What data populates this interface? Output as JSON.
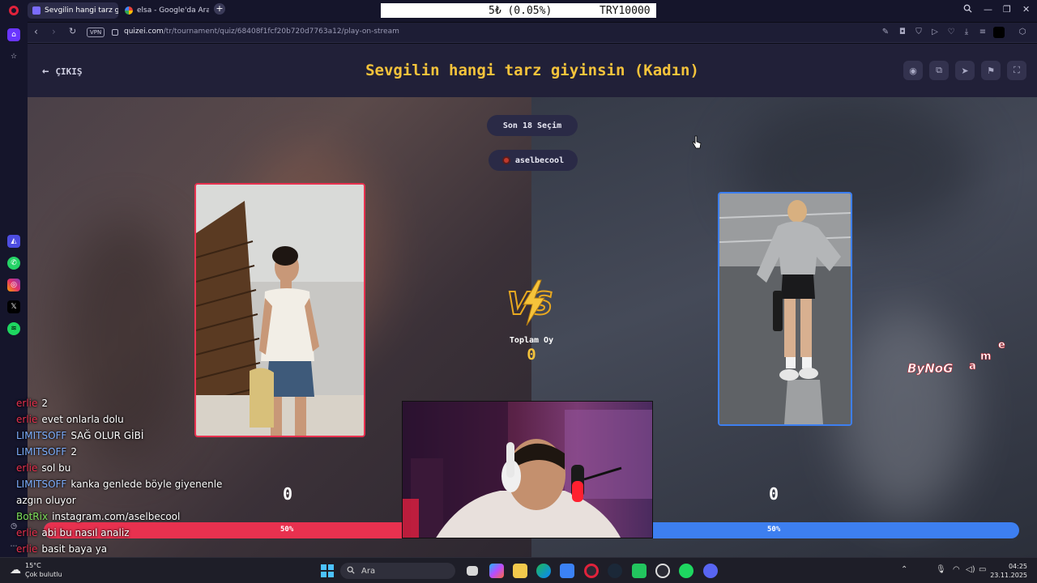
{
  "browser": {
    "tabs": [
      {
        "label": "Sevgilin hangi tarz giyinsin",
        "active": true
      },
      {
        "label": "elsa - Google'da Ara",
        "active": false
      }
    ],
    "new_tab_label": "+",
    "ticker": {
      "change": "5₺ (0.05%)",
      "balance": "TRY10000"
    },
    "vpn_label": "VPN",
    "url_host": "quizei.com",
    "url_path": "/tr/tournament/quiz/68408f1fcf20b720d7763a12/play-on-stream"
  },
  "page": {
    "exit_label": "ÇIKIŞ",
    "title": "Sevgilin hangi tarz giyinsin (Kadın)",
    "round_label": "Son 18 Seçim",
    "streamer": "aselbecool",
    "total_label": "Toplam Oy",
    "total_value": "0",
    "left_votes": "0",
    "right_votes": "0",
    "left_percent": "50%",
    "right_percent": "50%",
    "left_fraction": 0.5,
    "watermark": "ByNoGame",
    "colors": {
      "left": "#e8314f",
      "right": "#3d7ff0",
      "title": "#f5c33b"
    }
  },
  "chat": [
    {
      "user": "erlie",
      "color": "#e8314f",
      "text": "2"
    },
    {
      "user": "erlie",
      "color": "#e8314f",
      "text": "evet onlarla dolu"
    },
    {
      "user": "LIMITSOFF",
      "color": "#7fb0ff",
      "text": "SAĞ OLUR GİBİ"
    },
    {
      "user": "LIMITSOFF",
      "color": "#7fb0ff",
      "text": "2"
    },
    {
      "user": "erlie",
      "color": "#e8314f",
      "text": "sol bu"
    },
    {
      "user": "LIMITSOFF",
      "color": "#7fb0ff",
      "text": "kanka genlede böyle giyenenle"
    },
    {
      "user": "",
      "color": "#ffffff",
      "text": "azgın oluyor"
    },
    {
      "user": "BotRix",
      "color": "#7ee05b",
      "text": "instagram.com/aselbecool"
    },
    {
      "user": "erlie",
      "color": "#e8314f",
      "text": "abi bu nasıl analiz"
    },
    {
      "user": "erlie",
      "color": "#e8314f",
      "text": "basit baya ya"
    }
  ],
  "taskbar": {
    "temperature": "15°C",
    "weather_text": "Çok bulutlu",
    "search_placeholder": "Ara",
    "time": "04:25",
    "date": "23.11.2025"
  }
}
